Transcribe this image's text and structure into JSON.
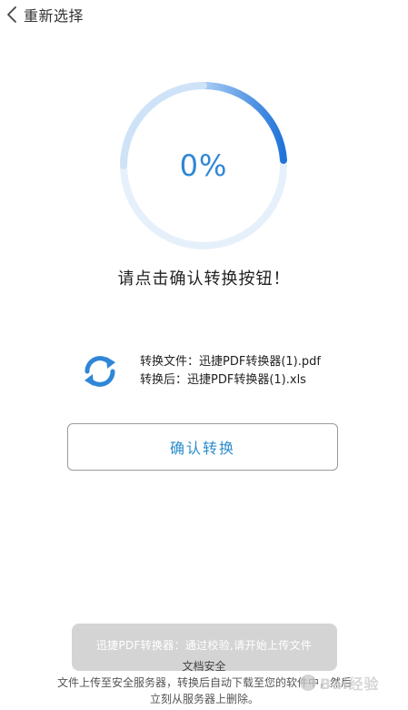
{
  "nav": {
    "back_label": "重新选择"
  },
  "progress": {
    "percent_label": "0%",
    "ring_color": "#2f86d6"
  },
  "hint": "请点击确认转换按钮！",
  "file_info": {
    "source_line": "转换文件：迅捷PDF转换器(1).pdf",
    "target_line": "转换后：迅捷PDF转换器(1).xls",
    "icon": "sync-icon"
  },
  "confirm_button": {
    "label": "确认转换"
  },
  "toast": {
    "text": "迅捷PDF转换器：通过校验,请开始上传文件"
  },
  "security": {
    "title": "文档安全",
    "description": "文件上传至安全服务器，转换后自动下载至您的软件中，然后立刻从服务器上删除。"
  },
  "watermark": {
    "text": "Bai经验"
  }
}
